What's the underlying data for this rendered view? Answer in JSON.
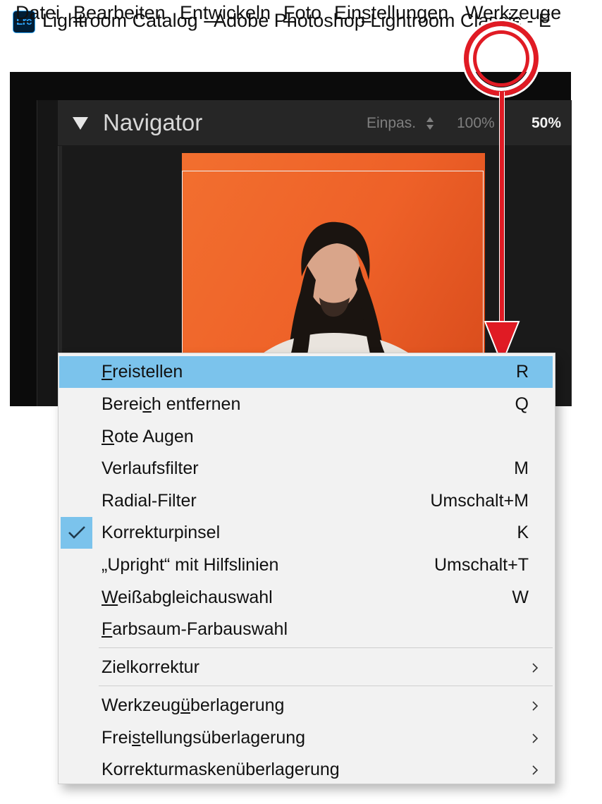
{
  "titlebar": {
    "app_icon_text": "Lrc",
    "title": "Lightroom Catalog - Adobe Photoshop Lightroom Classic - E"
  },
  "menubar": {
    "items": [
      {
        "pre": "",
        "u": "D",
        "post": "atei"
      },
      {
        "pre": "",
        "u": "B",
        "post": "earbeiten"
      },
      {
        "pre": "Ent",
        "u": "w",
        "post": "ickeln"
      },
      {
        "pre": "",
        "u": "F",
        "post": "oto"
      },
      {
        "pre": "Ein",
        "u": "s",
        "post": "tellungen"
      },
      {
        "pre": "Werk",
        "u": "z",
        "post": "euge"
      }
    ]
  },
  "navigator": {
    "title": "Navigator",
    "zoom_fit": "Einpas.",
    "zoom_100": "100%",
    "zoom_50": "50%"
  },
  "menu": {
    "items": [
      {
        "pre": "",
        "u": "F",
        "post": "reistellen",
        "shortcut": "R"
      },
      {
        "pre": "Berei",
        "u": "c",
        "post": "h entfernen",
        "shortcut": "Q"
      },
      {
        "pre": "",
        "u": "R",
        "post": "ote Augen",
        "shortcut": ""
      },
      {
        "pre": "Verlaufsfilter",
        "u": "",
        "post": "",
        "shortcut": "M"
      },
      {
        "pre": "Radial-Filter",
        "u": "",
        "post": "",
        "shortcut": "Umschalt+M"
      },
      {
        "pre": "Korrekturpinsel",
        "u": "",
        "post": "",
        "shortcut": "K"
      },
      {
        "pre": "„Upright“ mit Hilfslinien",
        "u": "",
        "post": "",
        "shortcut": "Umschalt+T"
      },
      {
        "pre": "",
        "u": "W",
        "post": "eißabgleichauswahl",
        "shortcut": "W"
      },
      {
        "pre": "",
        "u": "F",
        "post": "arbsaum-Farbauswahl",
        "shortcut": ""
      },
      {
        "pre": "Zielkorrektur",
        "u": "",
        "post": "",
        "shortcut": ""
      },
      {
        "pre": "Werkzeug",
        "u": "ü",
        "post": "berlagerung",
        "shortcut": ""
      },
      {
        "pre": "Frei",
        "u": "s",
        "post": "tellungsüberlagerung",
        "shortcut": ""
      },
      {
        "pre": "Korrekturmaskenüberlagerung",
        "u": "",
        "post": "",
        "shortcut": ""
      }
    ],
    "highlighted_index": 0,
    "checked_index": 5
  },
  "colors": {
    "highlight": "#7bc3ec",
    "callout": "#e01b24",
    "photo_background": "#ee6128"
  }
}
